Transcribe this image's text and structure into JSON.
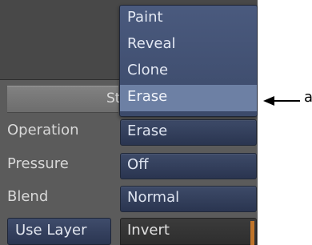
{
  "menu": {
    "items": [
      "Paint",
      "Reveal",
      "Clone",
      "Erase"
    ],
    "selected_index": 3
  },
  "section_bar_text": "St",
  "rows": [
    {
      "label": "Operation",
      "value": "Erase"
    },
    {
      "label": "Pressure",
      "value": "Off"
    },
    {
      "label": "Blend",
      "value": "Normal"
    }
  ],
  "use_layer_label": "Use Layer",
  "invert_value": "Invert",
  "callout": {
    "letter": "a"
  },
  "colors": {
    "panel": "#5b5b5b",
    "field": "#33405e",
    "menu_highlight": "#6d80a4",
    "accent": "#c0752a"
  }
}
